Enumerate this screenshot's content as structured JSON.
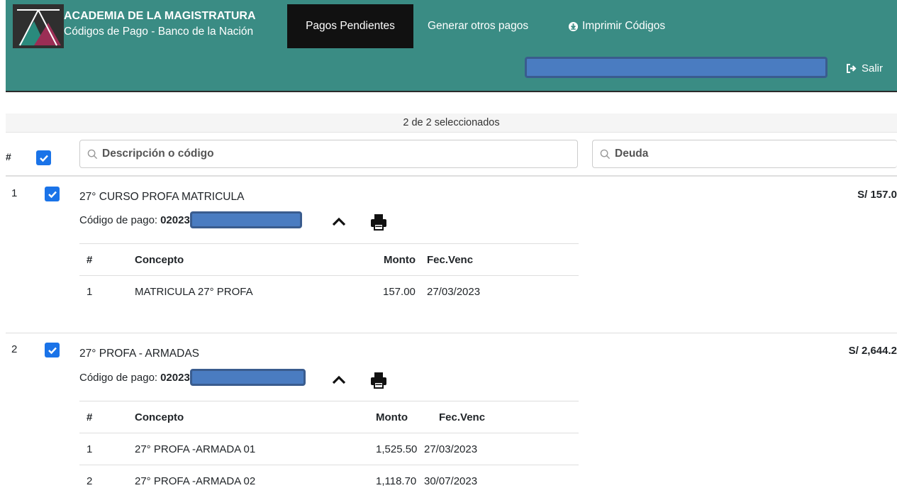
{
  "header": {
    "brand_title": "ACADEMIA DE LA MAGISTRATURA",
    "brand_subtitle": "Códigos de Pago - Banco de la Nación",
    "nav": {
      "pending": "Pagos Pendientes",
      "other": "Generar otros pagos",
      "print": "Imprimir Códigos"
    },
    "logout": "Salir",
    "colors": {
      "bar": "#3a8c84",
      "active_tab": "#111111",
      "checkbox": "#1a73e8"
    }
  },
  "selection": {
    "status": "2 de 2 seleccionados"
  },
  "filters": {
    "hash": "#",
    "description_placeholder": "Descripción o código",
    "debt_placeholder": "Deuda"
  },
  "items": [
    {
      "num": "1",
      "title": "27° CURSO PROFA MATRICULA",
      "amount": "S/ 157.0",
      "code_label": "Código de pago:",
      "code_prefix": "02023",
      "table": {
        "headers": {
          "num": "#",
          "concept": "Concepto",
          "amount": "Monto",
          "due": "Fec.Venc"
        },
        "rows": [
          {
            "num": "1",
            "concept": "MATRICULA 27° PROFA",
            "amount": "157.00",
            "due": "27/03/2023"
          }
        ]
      }
    },
    {
      "num": "2",
      "title": "27° PROFA - ARMADAS",
      "amount": "S/ 2,644.2",
      "code_label": "Código de pago:",
      "code_prefix": "02023",
      "table": {
        "headers": {
          "num": "#",
          "concept": "Concepto",
          "amount": "Monto",
          "due": "Fec.Venc"
        },
        "rows": [
          {
            "num": "1",
            "concept": "27° PROFA -ARMADA 01",
            "amount": "1,525.50",
            "due": "27/03/2023"
          },
          {
            "num": "2",
            "concept": "27° PROFA -ARMADA 02",
            "amount": "1,118.70",
            "due": "30/07/2023"
          }
        ]
      }
    }
  ]
}
